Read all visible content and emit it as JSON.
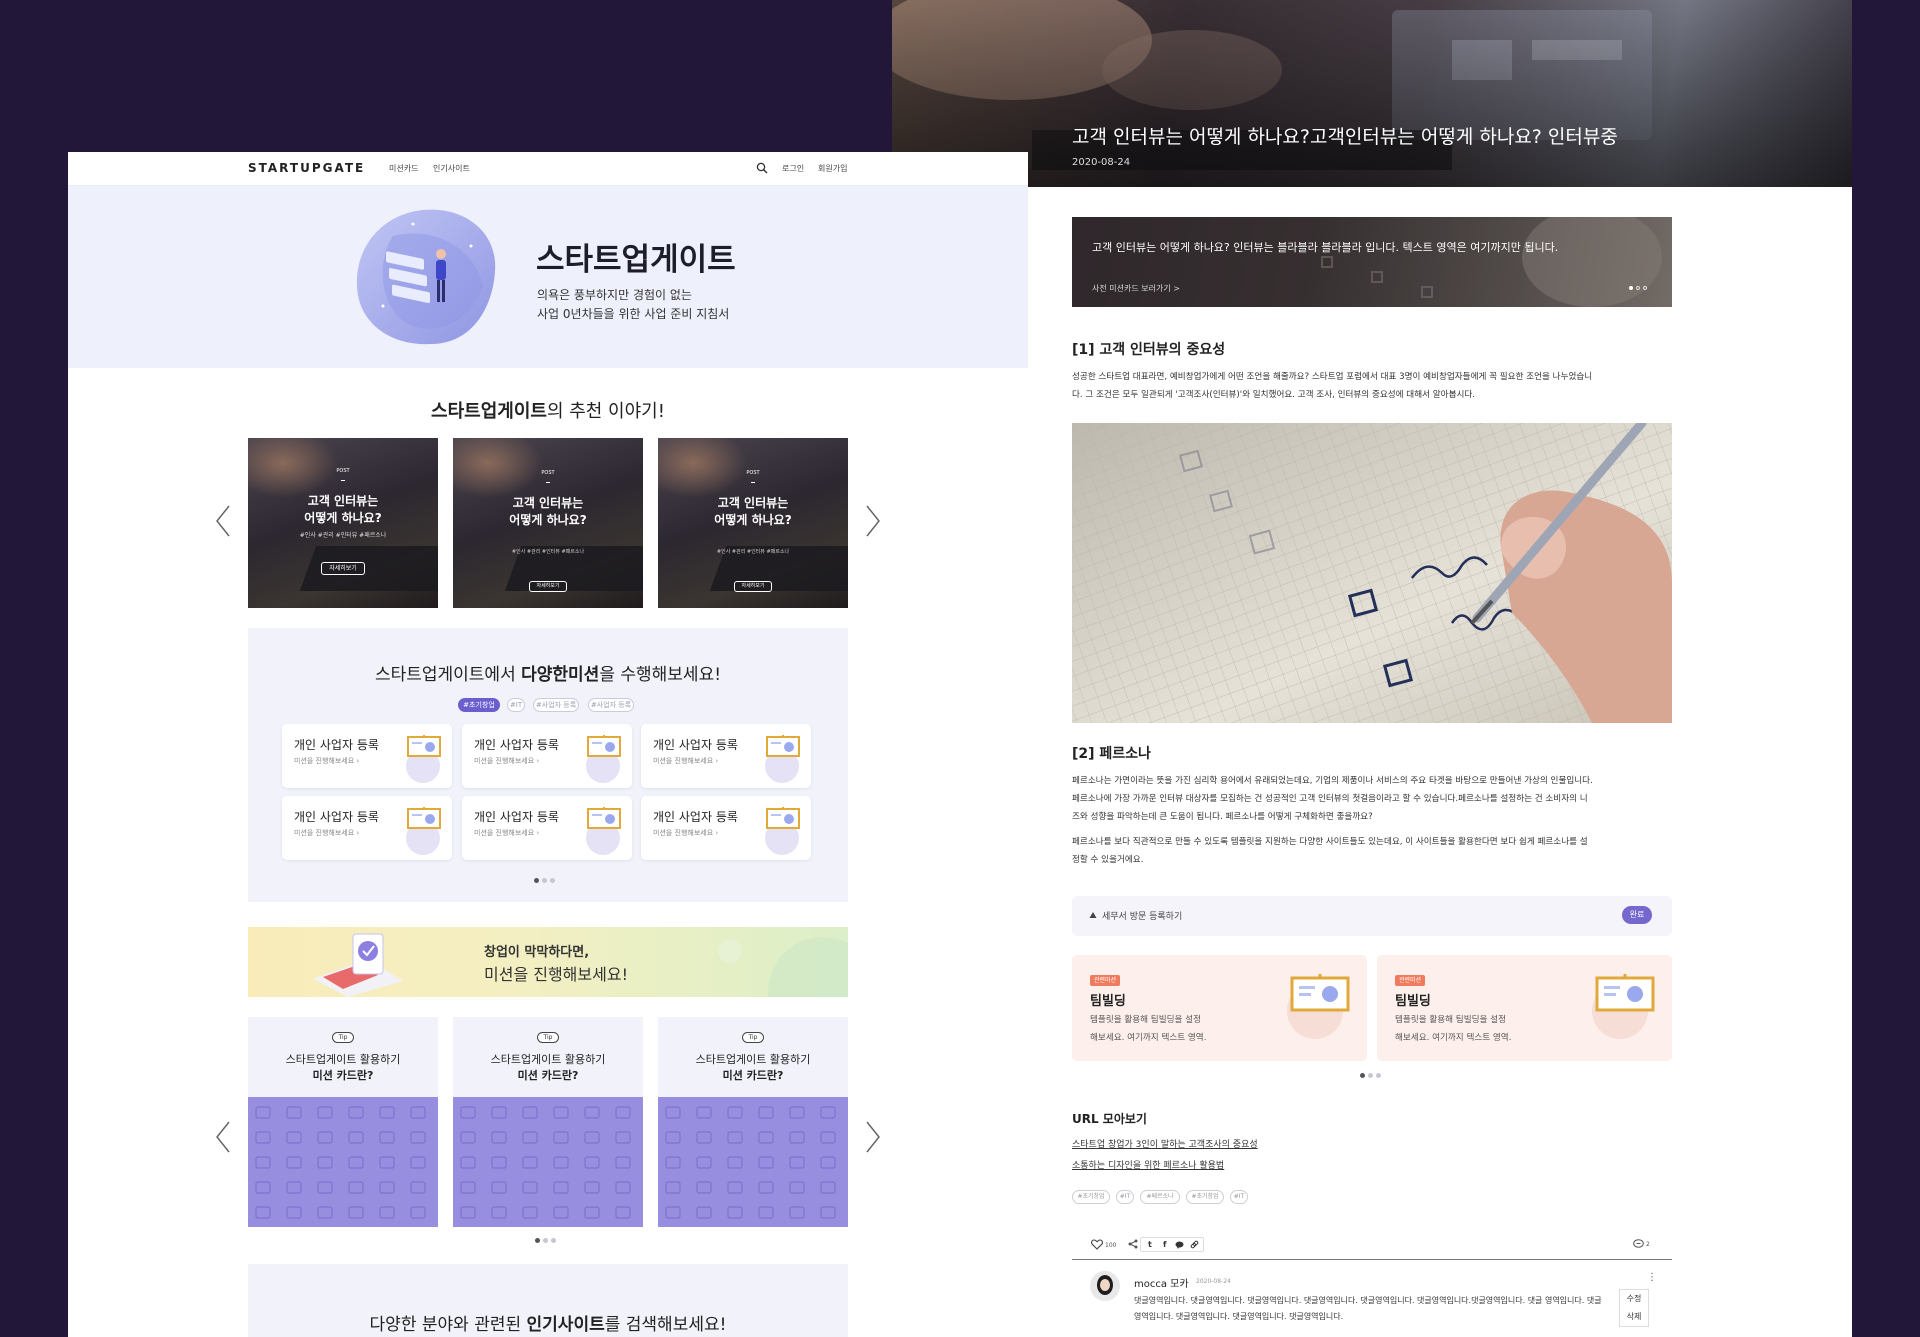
{
  "colors": {
    "background": "#221739",
    "accent": "#6b5fd0",
    "hero_bg": "#eef0fb",
    "pattern": "#978ee0",
    "badge": "#ef7b5e"
  },
  "left": {
    "nav": {
      "logo": "STARTUPGATE",
      "links": [
        "미션카드",
        "인기사이트"
      ],
      "login": "로그인",
      "signup": "회원가입",
      "search_icon": "search-icon"
    },
    "hero": {
      "title": "스타트업게이트",
      "sub1": "의욕은 풍부하지만 경험이 없는",
      "sub2": "사업 0년차들을 위한 사업 준비 지침서"
    },
    "recommend": {
      "title_bold": "스타트업게이트",
      "title_rest": "의 추천 이야기!",
      "cards": [
        {
          "kind": "POST",
          "line1": "고객 인터뷰는",
          "line2": "어떻게 하나요?",
          "tags": "#인사 #관리 #인터뷰 #패르소나",
          "button": "자세히보기"
        },
        {
          "kind": "POST",
          "line1": "고객 인터뷰는",
          "line2": "어떻게 하나요?",
          "tags": "#인사 #관리 #인터뷰 #패르소나",
          "button": "자세히보기"
        },
        {
          "kind": "POST",
          "line1": "고객 인터뷰는",
          "line2": "어떻게 하나요?",
          "tags": "#인사 #관리 #인터뷰 #패르소나",
          "button": "자세히보기"
        }
      ]
    },
    "missions": {
      "title_pre": "스타트업게이트에서 ",
      "title_bold": "다양한미션",
      "title_post": "을 수행해보세요!",
      "tags": [
        "#초기창업",
        "#IT",
        "#사업자 등록",
        "#사업자 등록"
      ],
      "cards": [
        {
          "title": "개인 사업자 등록",
          "sub": "미션을 진행해보세요"
        },
        {
          "title": "개인 사업자 등록",
          "sub": "미션을 진행해보세요"
        },
        {
          "title": "개인 사업자 등록",
          "sub": "미션을 진행해보세요"
        },
        {
          "title": "개인 사업자 등록",
          "sub": "미션을 진행해보세요"
        },
        {
          "title": "개인 사업자 등록",
          "sub": "미션을 진행해보세요"
        },
        {
          "title": "개인 사업자 등록",
          "sub": "미션을 진행해보세요"
        }
      ]
    },
    "banner": {
      "line1": "창업이 막막하다면,",
      "line2": "미션을 진행해보세요!"
    },
    "tips": [
      {
        "badge": "Tip",
        "line1": "스타트업게이트 활용하기",
        "line2": "미션 카드란?"
      },
      {
        "badge": "Tip",
        "line1": "스타트업게이트 활용하기",
        "line2": "미션 카드란?"
      },
      {
        "badge": "Tip",
        "line1": "스타트업게이트 활용하기",
        "line2": "미션 카드란?"
      }
    ],
    "bottom": {
      "pre": "다양한 분야와 관련된 ",
      "bold": "인기사이트",
      "post": "를 검색해보세요!"
    }
  },
  "right": {
    "hero": {
      "title": "고객 인터뷰는 어떻게 하나요?고객인터뷰는 어떻게 하나요? 인터뷰중",
      "date": "2020-08-24"
    },
    "banner": {
      "text": "고객 인터뷰는 어떻게 하나요? 인터뷰는 블라블라 블라블라 입니다. 텍스트 영역은 여기까지만 됩니다.",
      "link": "사전 미션카드 보러가기 >"
    },
    "section1": {
      "title": "[1] 고객 인터뷰의 중요성",
      "p1": "성공한 스타트업 대표라면, 예비창업가에게 어떤 조언을 해줄까요? 스타트업 포럼에서 대표 3명이 예비창업자들에게 꼭 필요한 조언을 나누었습니",
      "p2": "다. 그 조건은 모두 일관되게 '고객조사(인터뷰)'와 일치했어요. 고객 조사, 인터뷰의 중요성에 대해서 알아봅시다."
    },
    "section2": {
      "title": "[2] 페르소나",
      "p1": "페르소나는 가면이라는 뜻을 가진 심리학 용어에서 유래되었는데요, 기업의 제품이나 서비스의 주요 타겟을 바탕으로 만들어낸 가상의 인물입니다.",
      "p2": "페르소나에 가장 가까운 인터뷰 대상자를 모집하는 건 성공적인 고객 인터뷰의 첫걸음이라고 할 수 있습니다.페르소나를 설정하는 건 소비자의 니",
      "p3": "즈와 성향을 파악하는데 큰 도움이 됩니다. 페르소나를 어떻게 구체화하면 좋을까요?",
      "p4": "페르소나를 보다 직관적으로 만들 수 있도록 템플릿을 지원하는 다양한 사이트들도 있는데요, 이 사이트들을 활용한다면 보다 쉽게 페르소나를 설",
      "p5": "정할 수 있을거에요."
    },
    "accordion": {
      "label": "세무서 방문 등록하기",
      "badge": "완료"
    },
    "related": [
      {
        "badge": "관련미션",
        "title": "팀빌딩",
        "d1": "템플릿을 활용해 팀빌딩을 설정",
        "d2": "해보세요. 여기까지 텍스트 영역."
      },
      {
        "badge": "관련미션",
        "title": "팀빌딩",
        "d1": "템플릿을 활용해 팀빌딩을 설정",
        "d2": "해보세요. 여기까지 텍스트 영역."
      }
    ],
    "urls": {
      "title": "URL 모아보기",
      "links": [
        "스타트업 창업가 3인이 말하는 고객조사의 중요성",
        "소통하는 디자인을 위한 페르소나 활용법"
      ]
    },
    "tags": [
      "#초기창업",
      "#IT",
      "#페르소나",
      "#초기창업",
      "#IT"
    ],
    "social": {
      "likes": "100",
      "comments": "2"
    },
    "comment": {
      "author": "mocca 모카",
      "date": "2020-08-24",
      "line1": "댓글영역입니다. 댓글영역입니다. 댓글영역입니다. 댓글영역입니다. 댓글영역입니다. 댓글영역입니다.댓글영역입니다. 댓글 영역입니다. 댓글",
      "line2": "영역입니다. 댓글영역입니다. 댓글영역입니다. 댓글영역입니다.",
      "edit": "수정",
      "delete": "삭제"
    }
  }
}
